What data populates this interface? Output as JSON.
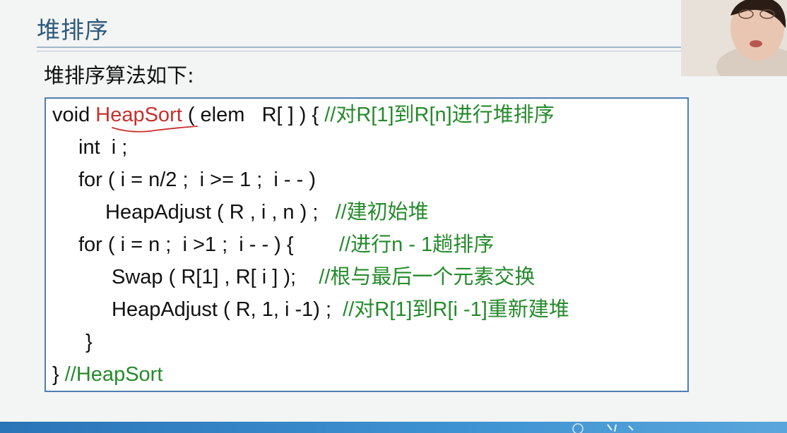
{
  "slide": {
    "title": "堆排序",
    "subtitle": "堆排序算法如下:"
  },
  "code": {
    "l1_pre": "void ",
    "l1_fn": "HeapSort",
    "l1_mid": " ( elem   R[ ] ) { ",
    "l1_comment": "//对R[1]到R[n]进行堆排序",
    "l2": "int  i ;",
    "l3": "for ( i = n/2 ;  i >= 1 ;  i - - )",
    "l4_code": "HeapAdjust ( R , i , n ) ;   ",
    "l4_comment": "//建初始堆",
    "l5_code": "for ( i = n ;  i >1 ;  i - - ) {        ",
    "l5_comment": "//进行n - 1趟排序",
    "l6_code": "Swap ( R[1] , R[ i ] );    ",
    "l6_comment": "//根与最后一个元素交换",
    "l7_code": "HeapAdjust ( R, 1, i -1) ;  ",
    "l7_comment": "//对R[1]到R[i -1]重新建堆",
    "l8": "}",
    "l9_pre": "} ",
    "l9_comment": "//HeapSort"
  },
  "colors": {
    "title": "#2e5a7c",
    "highlight_function": "#c6302d",
    "comment": "#268a2c",
    "box_border": "#4f7fb2"
  }
}
